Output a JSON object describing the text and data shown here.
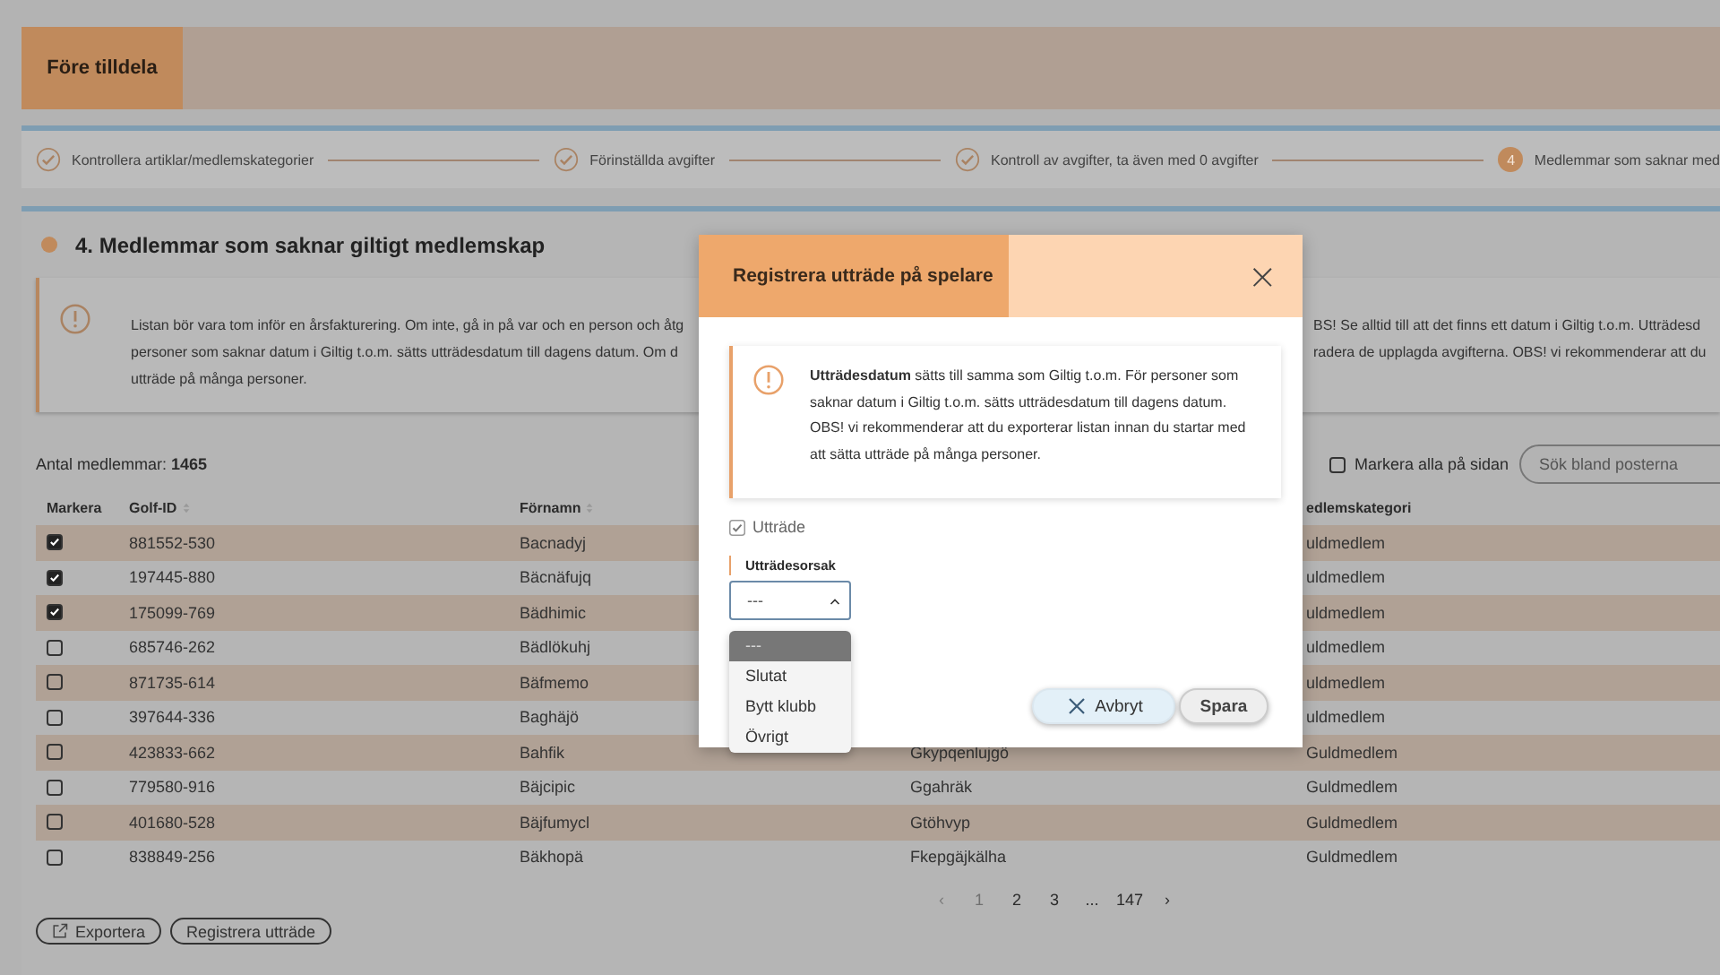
{
  "header": {
    "title": "Före tilldela"
  },
  "steps": [
    {
      "label": "Kontrollera artiklar/medlemskategorier",
      "done": true
    },
    {
      "label": "Förinställda avgifter",
      "done": true
    },
    {
      "label": "Kontroll av avgifter, ta även med 0 avgifter",
      "done": true
    },
    {
      "label": "Medlemmar som saknar med",
      "done": false,
      "number": "4"
    }
  ],
  "section": {
    "title": "4. Medlemmar som saknar giltigt medlemskap",
    "info_left": [
      "Listan bör vara tom inför en årsfakturering. Om inte, gå in på var och en person och åtg",
      "personer som saknar datum i Giltig t.o.m. sätts utträdesdatum till dagens datum. Om d",
      "utträde på många personer."
    ],
    "info_right": [
      "BS! Se alltid till att det finns ett datum i Giltig t.o.m. Utträdesd",
      "radera de upplagda avgifterna. OBS! vi rekommenderar att du"
    ]
  },
  "count": {
    "label": "Antal medlemmar:",
    "value": "1465"
  },
  "select_all": {
    "label": "Markera alla på sidan",
    "checked": false
  },
  "search": {
    "placeholder": "Sök bland posterna"
  },
  "table": {
    "columns": [
      {
        "label": "Markera",
        "sortable": false
      },
      {
        "label": "Golf-ID",
        "sortable": true
      },
      {
        "label": "Förnamn",
        "sortable": true
      },
      {},
      {
        "label": "edlemskategori",
        "sortable": false
      }
    ],
    "rows": [
      {
        "checked": true,
        "golf_id": "881552-530",
        "first_name": "Bacnadyj",
        "category": "uldmedlem"
      },
      {
        "checked": true,
        "golf_id": "197445-880",
        "first_name": "Bäcnäfujq",
        "category": "uldmedlem"
      },
      {
        "checked": true,
        "golf_id": "175099-769",
        "first_name": "Bädhimic",
        "category": "uldmedlem"
      },
      {
        "checked": false,
        "golf_id": "685746-262",
        "first_name": "Bädlökuhj",
        "category": "uldmedlem"
      },
      {
        "checked": false,
        "golf_id": "871735-614",
        "first_name": "Bäfmemo",
        "category": "uldmedlem"
      },
      {
        "checked": false,
        "golf_id": "397644-336",
        "first_name": "Baghäjö",
        "category": "uldmedlem"
      },
      {
        "checked": false,
        "golf_id": "423833-662",
        "first_name": "Bahfik",
        "column_4": "Gkypqenlujgö",
        "category": "Guldmedlem"
      },
      {
        "checked": false,
        "golf_id": "779580-916",
        "first_name": "Bäjcipic",
        "column_4": "Ggahräk",
        "category": "Guldmedlem"
      },
      {
        "checked": false,
        "golf_id": "401680-528",
        "first_name": "Bäjfumycl",
        "column_4": "Gtöhvyp",
        "category": "Guldmedlem"
      },
      {
        "checked": false,
        "golf_id": "838849-256",
        "first_name": "Bäkhopä",
        "column_4": "Fkepgäjkälha",
        "category": "Guldmedlem"
      }
    ]
  },
  "pagination": {
    "prev": "‹",
    "pages": [
      {
        "label": "1",
        "selected": true
      },
      {
        "label": "2",
        "selected": false
      },
      {
        "label": "3",
        "selected": false
      },
      {
        "label": "...",
        "selected": false
      },
      {
        "label": "147",
        "selected": false
      }
    ],
    "next": "›"
  },
  "actions": [
    {
      "label": "Exportera",
      "icon": true
    },
    {
      "label": "Registrera utträde",
      "icon": false
    }
  ],
  "modal": {
    "title": "Registrera utträde på spelare",
    "close": "×",
    "info": "**Utträdesdatum** sätts till samma som Giltig t.o.m. För personer som saknar datum i Giltig t.o.m. sätts utträdesdatum till dagens datum. OBS! vi rekommenderar att du exporterar listan innan du startar med att sätta utträde på många personer.",
    "checkbox": {
      "label": "Utträde",
      "checked": true
    },
    "reason_label": "Utträdesorsak",
    "select": {
      "value": "---",
      "expanded": true
    },
    "options": [
      {
        "label": "---",
        "selected": true
      },
      {
        "label": "Slutat",
        "selected": false
      },
      {
        "label": "Bytt klubb",
        "selected": false
      },
      {
        "label": "Övrigt",
        "selected": false
      }
    ],
    "cancel": "Avbryt",
    "save": "Spara"
  }
}
